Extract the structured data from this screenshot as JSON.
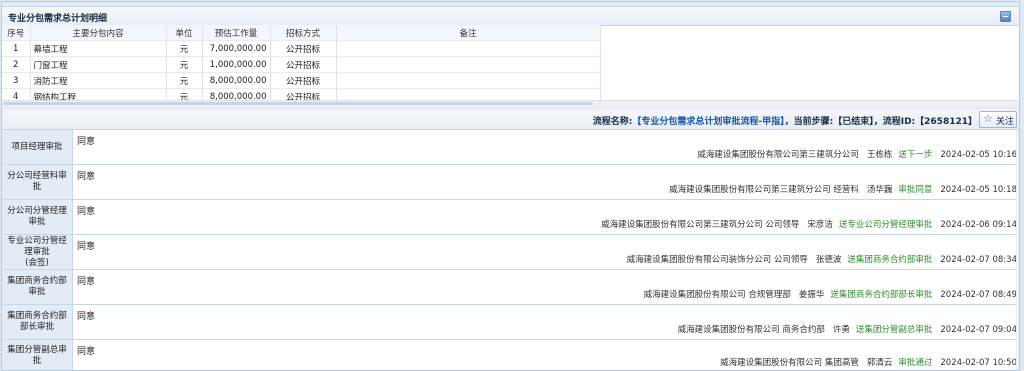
{
  "panel": {
    "title": "专业分包需求总计划明细"
  },
  "plan_table": {
    "headers": [
      "序号",
      "主要分包内容",
      "单位",
      "预估工作量",
      "招标方式",
      "备注"
    ],
    "rows": [
      [
        "1",
        "幕墙工程",
        "元",
        "7,000,000.00",
        "公开招标",
        ""
      ],
      [
        "2",
        "门窗工程",
        "元",
        "1,000,000.00",
        "公开招标",
        ""
      ],
      [
        "3",
        "消防工程",
        "元",
        "8,000,000.00",
        "公开招标",
        ""
      ],
      [
        "4",
        "钢结构工程",
        "元",
        "8,000,000.00",
        "公开招标",
        ""
      ]
    ]
  },
  "flow": {
    "name_label": "流程名称:",
    "name": "【专业分包需求总计划审批流程-甲指】",
    "step_label": "，当前步骤:",
    "step": "【已结束】",
    "id_label": "，流程ID:",
    "id": "【2658121】",
    "follow_label": "关注"
  },
  "approvals": [
    {
      "label": "项目经理审批",
      "opinion": "同意",
      "org": "威海建设集团股份有限公司第三建筑分公司",
      "person": "王栋栋",
      "action": "送下一步",
      "time": "2024-02-05 10:16"
    },
    {
      "label": "分公司经营科审批",
      "opinion": "同意",
      "org": "威海建设集团股份有限公司第三建筑分公司 经营科",
      "person": "汤华巍",
      "action": "审批同意",
      "time": "2024-02-05 10:18"
    },
    {
      "label": "分公司分管经理审批",
      "opinion": "同意",
      "org": "威海建设集团股份有限公司第三建筑分公司 公司领导",
      "person": "宋彦洁",
      "action": "送专业公司分管经理审批",
      "time": "2024-02-06 09:14"
    },
    {
      "label": "专业公司分管经理审批",
      "label_suffix": "(会签)",
      "opinion": "同意",
      "org": "威海建设集团股份有限公司装饰分公司 公司领导",
      "person": "张德波",
      "action": "送集团商务合约部审批",
      "time": "2024-02-07 08:34"
    },
    {
      "label": "集团商务合约部审批",
      "opinion": "同意",
      "org": "威海建设集团股份有限公司 合规管理部",
      "person": "姜振华",
      "action": "送集团商务合约部部长审批",
      "time": "2024-02-07 08:49"
    },
    {
      "label": "集团商务合约部部长审批",
      "opinion": "同意",
      "org": "威海建设集团股份有限公司 商务合约部",
      "person": "许勇",
      "action": "送集团分管副总审批",
      "time": "2024-02-07 09:04"
    },
    {
      "label": "集团分管副总审批",
      "opinion": "同意",
      "org": "威海建设集团股份有限公司 集团高管",
      "person": "郭清云",
      "action": "审批通过",
      "time": "2024-02-07 10:50"
    }
  ]
}
